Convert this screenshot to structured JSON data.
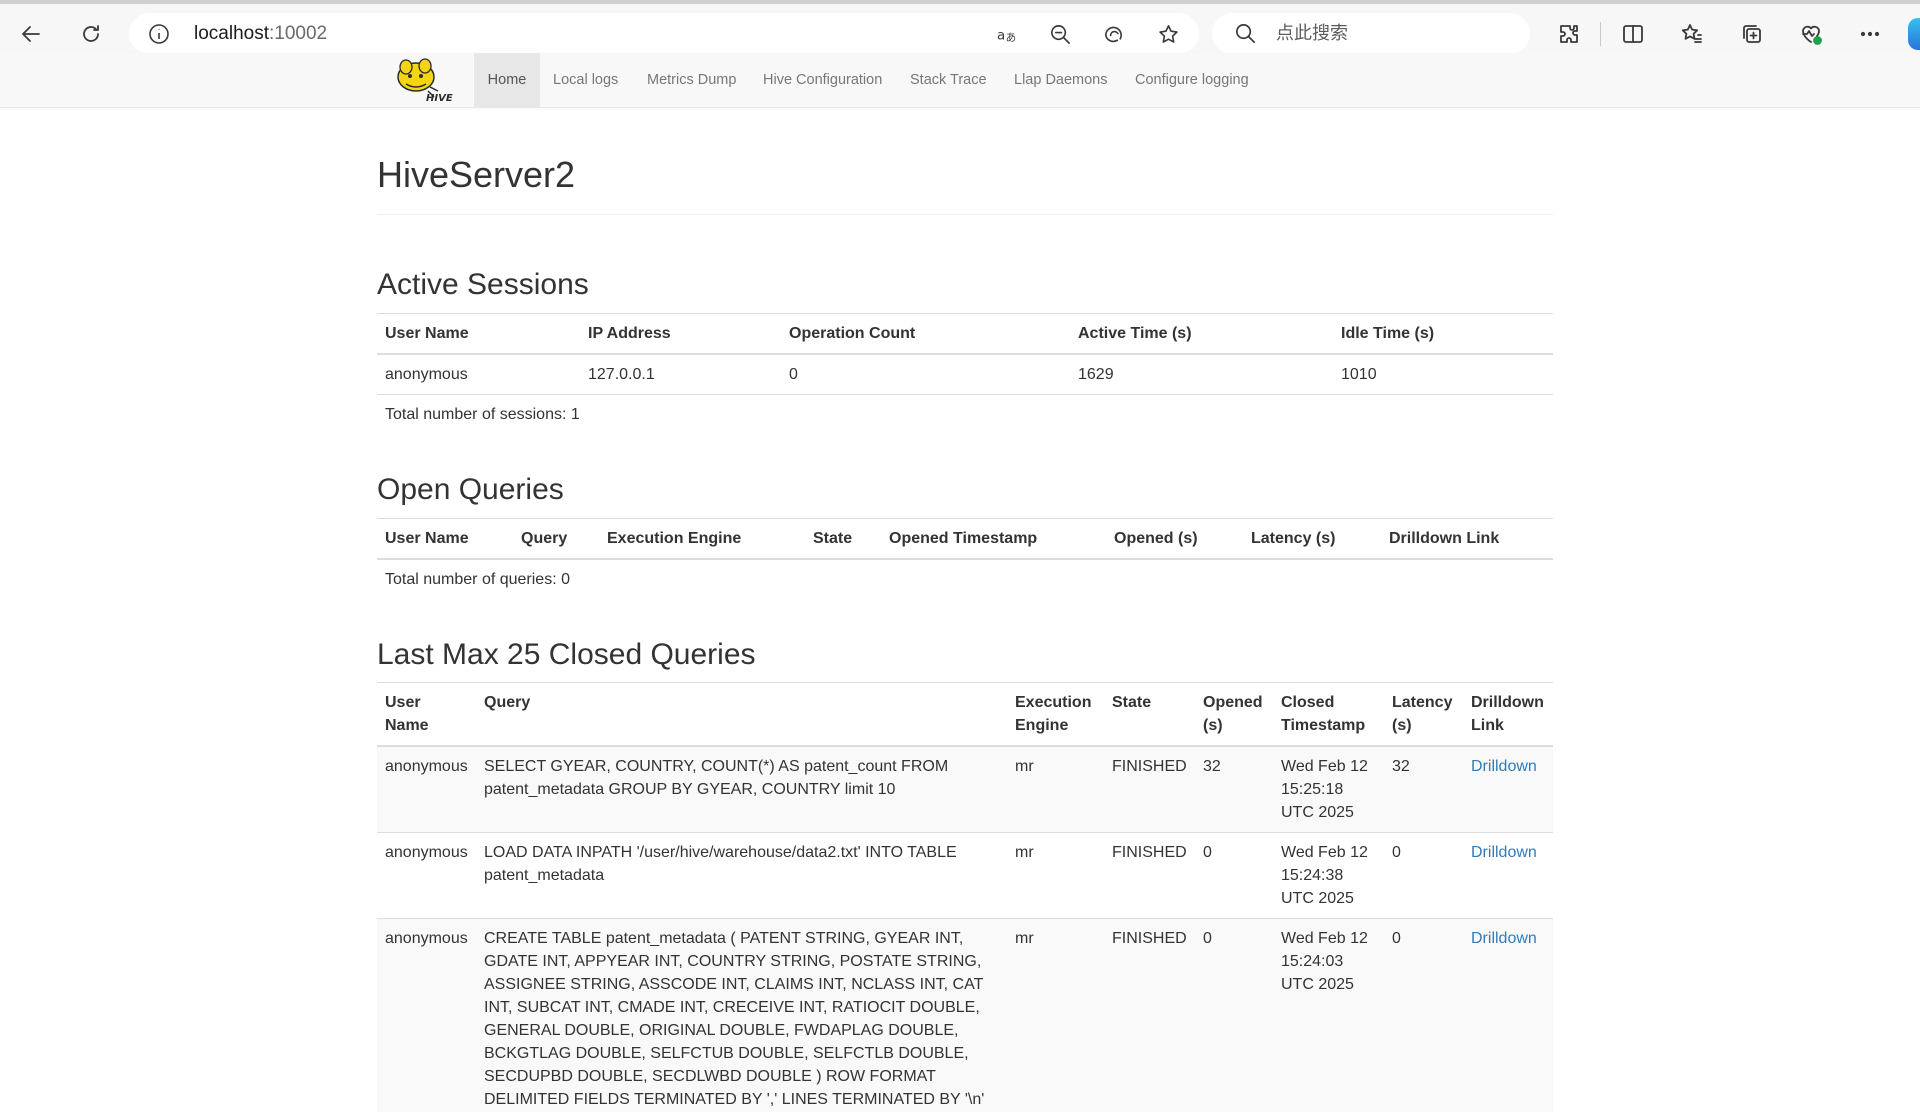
{
  "browser": {
    "url_host": "localhost",
    "url_port": ":10002",
    "search_placeholder": "点此搜索",
    "colors": {
      "chrome_bg": "#f7f7f7",
      "accent": "#337ab7"
    }
  },
  "navbar": {
    "logo_text": "HIVE",
    "items": [
      {
        "label": "Home",
        "active": true
      },
      {
        "label": "Local logs"
      },
      {
        "label": "Metrics Dump"
      },
      {
        "label": "Hive Configuration"
      },
      {
        "label": "Stack Trace"
      },
      {
        "label": "Llap Daemons"
      },
      {
        "label": "Configure logging"
      }
    ]
  },
  "page": {
    "title": "HiveServer2"
  },
  "active_sessions": {
    "heading": "Active Sessions",
    "columns": [
      "User Name",
      "IP Address",
      "Operation Count",
      "Active Time (s)",
      "Idle Time (s)"
    ],
    "rows": [
      [
        "anonymous",
        "127.0.0.1",
        "0",
        "1629",
        "1010"
      ]
    ],
    "total": "Total number of sessions: 1"
  },
  "open_queries": {
    "heading": "Open Queries",
    "columns": [
      "User Name",
      "Query",
      "Execution Engine",
      "State",
      "Opened Timestamp",
      "Opened (s)",
      "Latency (s)",
      "Drilldown Link"
    ],
    "total": "Total number of queries: 0"
  },
  "closed_queries": {
    "heading": "Last Max 25 Closed Queries",
    "columns": [
      "User Name",
      "Query",
      "Execution Engine",
      "State",
      "Opened (s)",
      "Closed Timestamp",
      "Latency (s)",
      "Drilldown Link"
    ],
    "rows": [
      {
        "user": "anonymous",
        "query": "SELECT GYEAR, COUNTRY, COUNT(*) AS patent_count FROM patent_metadata GROUP BY GYEAR, COUNTRY limit 10",
        "engine": "mr",
        "state": "FINISHED",
        "opened": "32",
        "closed": "Wed Feb 12 15:25:18 UTC 2025",
        "latency": "32",
        "link": "Drilldown"
      },
      {
        "user": "anonymous",
        "query": "LOAD DATA INPATH '/user/hive/warehouse/data2.txt' INTO TABLE patent_metadata",
        "engine": "mr",
        "state": "FINISHED",
        "opened": "0",
        "closed": "Wed Feb 12 15:24:38 UTC 2025",
        "latency": "0",
        "link": "Drilldown"
      },
      {
        "user": "anonymous",
        "query": "CREATE TABLE patent_metadata ( PATENT STRING, GYEAR INT, GDATE INT, APPYEAR INT, COUNTRY STRING, POSTATE STRING, ASSIGNEE STRING, ASSCODE INT, CLAIMS INT, NCLASS INT, CAT INT, SUBCAT INT, CMADE INT, CRECEIVE INT, RATIOCIT DOUBLE, GENERAL DOUBLE, ORIGINAL DOUBLE, FWDAPLAG DOUBLE, BCKGTLAG DOUBLE, SELFCTUB DOUBLE, SELFCTLB DOUBLE, SECDUPBD DOUBLE, SECDLWBD DOUBLE ) ROW FORMAT DELIMITED FIELDS TERMINATED BY ',' LINES TERMINATED BY '\\n'",
        "engine": "mr",
        "state": "FINISHED",
        "opened": "0",
        "closed": "Wed Feb 12 15:24:03 UTC 2025",
        "latency": "0",
        "link": "Drilldown"
      }
    ]
  }
}
